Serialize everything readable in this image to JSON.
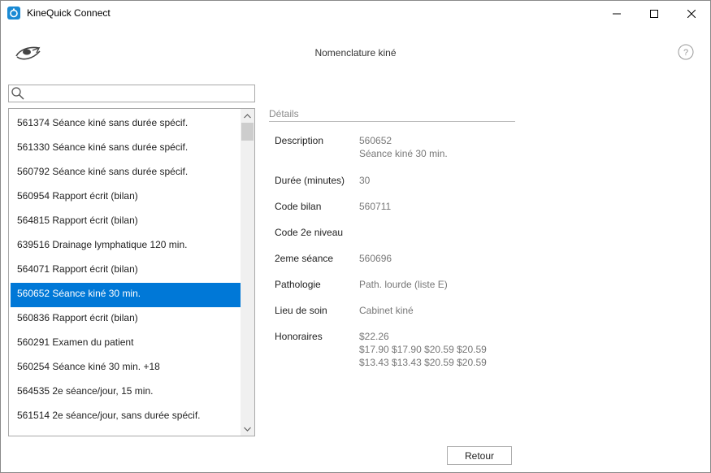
{
  "window": {
    "title": "KineQuick Connect"
  },
  "header": {
    "title": "Nomenclature kiné",
    "help_glyph": "?"
  },
  "search": {
    "value": "",
    "placeholder": ""
  },
  "list": {
    "items": [
      {
        "label": "561374 Séance kiné sans durée spécif.",
        "selected": false
      },
      {
        "label": "561330 Séance kiné sans durée spécif.",
        "selected": false
      },
      {
        "label": "560792 Séance kiné sans durée spécif.",
        "selected": false
      },
      {
        "label": "560954 Rapport écrit (bilan)",
        "selected": false
      },
      {
        "label": "564815 Rapport écrit (bilan)",
        "selected": false
      },
      {
        "label": "639516 Drainage lymphatique 120 min.",
        "selected": false
      },
      {
        "label": "564071 Rapport écrit (bilan)",
        "selected": false
      },
      {
        "label": "560652 Séance kiné 30 min.",
        "selected": true
      },
      {
        "label": "560836 Rapport écrit (bilan)",
        "selected": false
      },
      {
        "label": "560291 Examen du patient",
        "selected": false
      },
      {
        "label": "560254 Séance kiné 30 min. +18",
        "selected": false
      },
      {
        "label": "564535 2e séance/jour, 15 min.",
        "selected": false
      },
      {
        "label": "561514 2e séance/jour, sans durée spécif.",
        "selected": false
      }
    ]
  },
  "details": {
    "heading": "Détails",
    "fields": [
      {
        "label": "Description",
        "value": [
          "560652",
          "Séance kiné 30 min."
        ]
      },
      {
        "label": "Durée (minutes)",
        "value": [
          "30"
        ]
      },
      {
        "label": "Code bilan",
        "value": [
          "560711"
        ]
      },
      {
        "label": "Code 2e niveau",
        "value": [
          ""
        ]
      },
      {
        "label": "2eme séance",
        "value": [
          "560696"
        ]
      },
      {
        "label": "Pathologie",
        "value": [
          "Path. lourde (liste E)"
        ]
      },
      {
        "label": "Lieu de soin",
        "value": [
          "Cabinet kiné"
        ]
      },
      {
        "label": "Honoraires",
        "value": [
          "$22.26",
          "$17.90 $17.90 $20.59 $20.59",
          "$13.43 $13.43 $20.59 $20.59"
        ]
      }
    ]
  },
  "footer": {
    "back_label": "Retour"
  },
  "colors": {
    "selection": "#0078d7",
    "app_icon": "#1a8ad4"
  }
}
